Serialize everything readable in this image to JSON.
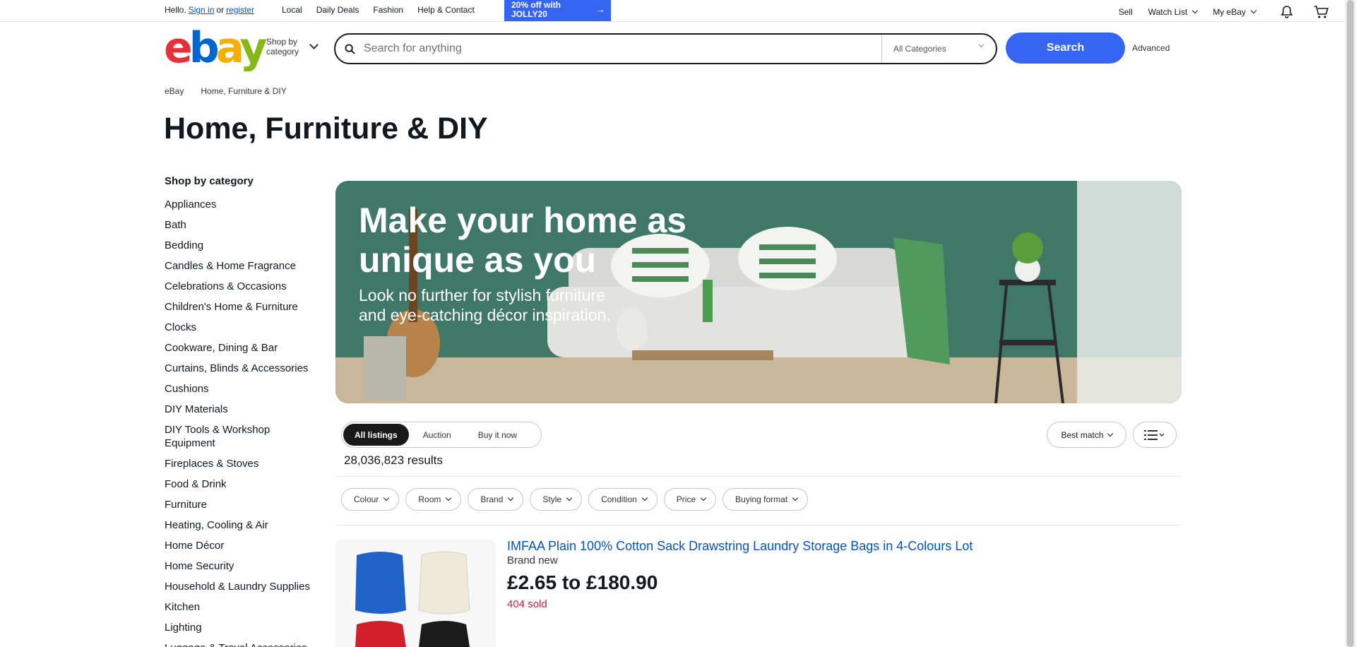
{
  "topbar": {
    "hello": "Hello.",
    "sign_in": "Sign in",
    "or": "or",
    "register": "register",
    "links": [
      "Local",
      "Daily Deals",
      "Fashion",
      "Help & Contact"
    ],
    "promo_line1": "20% off with",
    "promo_line2": "JOLLY20",
    "sell": "Sell",
    "watch_list": "Watch List",
    "my_ebay": "My eBay"
  },
  "header": {
    "logo": {
      "e": "e",
      "b": "b",
      "a": "a",
      "y": "y"
    },
    "shop_by_line1": "Shop by",
    "shop_by_line2": "category",
    "search_placeholder": "Search for anything",
    "category_select": "All Categories",
    "search_button": "Search",
    "advanced": "Advanced"
  },
  "breadcrumb": [
    "eBay",
    "Home, Furniture & DIY"
  ],
  "page_title": "Home, Furniture & DIY",
  "sidebar": {
    "heading": "Shop by category",
    "categories": [
      "Appliances",
      "Bath",
      "Bedding",
      "Candles & Home Fragrance",
      "Celebrations & Occasions",
      "Children's Home & Furniture",
      "Clocks",
      "Cookware, Dining & Bar",
      "Curtains, Blinds & Accessories",
      "Cushions",
      "DIY Materials",
      "DIY Tools & Workshop Equipment",
      "Fireplaces & Stoves",
      "Food & Drink",
      "Furniture",
      "Heating, Cooling & Air",
      "Home Décor",
      "Home Security",
      "Household & Laundry Supplies",
      "Kitchen",
      "Lighting",
      "Luggage & Travel Accessories"
    ]
  },
  "banner": {
    "headline_line1": "Make your home as",
    "headline_line2": "unique as you",
    "sub_line1": "Look no further for stylish furniture",
    "sub_line2": "and eye-catching décor inspiration."
  },
  "tabs": [
    "All listings",
    "Auction",
    "Buy it now"
  ],
  "sort_label": "Best match",
  "results_count": "28,036,823 results",
  "filters": [
    "Colour",
    "Room",
    "Brand",
    "Style",
    "Condition",
    "Price",
    "Buying format"
  ],
  "listing": {
    "title": "IMFAA Plain 100% Cotton Sack Drawstring Laundry Storage Bags in 4-Colours Lot",
    "condition": "Brand new",
    "price": "£2.65 to £180.90",
    "sold": "404 sold"
  },
  "colors": {
    "accent_blue": "#3665f3",
    "link_blue": "#0654ba",
    "banner_green": "#3e7766",
    "sold_red": "#c3203f"
  }
}
